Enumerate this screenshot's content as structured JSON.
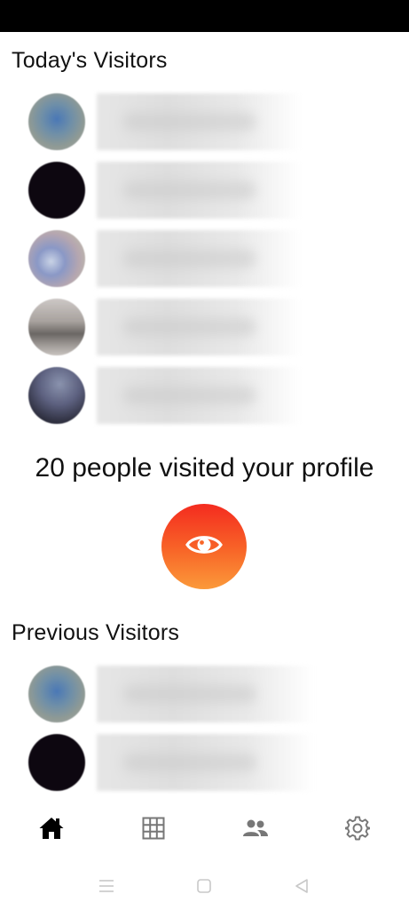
{
  "today": {
    "title": "Today's Visitors",
    "visitors": [
      {
        "avatar": "blurred-avatar"
      },
      {
        "avatar": "blurred-avatar"
      },
      {
        "avatar": "blurred-avatar"
      },
      {
        "avatar": "blurred-avatar"
      },
      {
        "avatar": "blurred-avatar"
      }
    ]
  },
  "summary": {
    "visited_text": "20 people visited your profile",
    "reveal_icon": "eye-icon",
    "button_colors": [
      "#f42b1f",
      "#fb9a3a"
    ]
  },
  "previous": {
    "title": "Previous Visitors",
    "visitors": [
      {
        "avatar": "blurred-avatar"
      },
      {
        "avatar": "blurred-avatar"
      }
    ]
  },
  "bottom_nav": {
    "items": [
      {
        "icon": "home-icon",
        "active": true
      },
      {
        "icon": "grid-icon",
        "active": false
      },
      {
        "icon": "people-icon",
        "active": false
      },
      {
        "icon": "gear-icon",
        "active": false
      }
    ]
  },
  "system_nav": {
    "icons": [
      "menu-icon",
      "square-icon",
      "back-triangle-icon"
    ]
  }
}
